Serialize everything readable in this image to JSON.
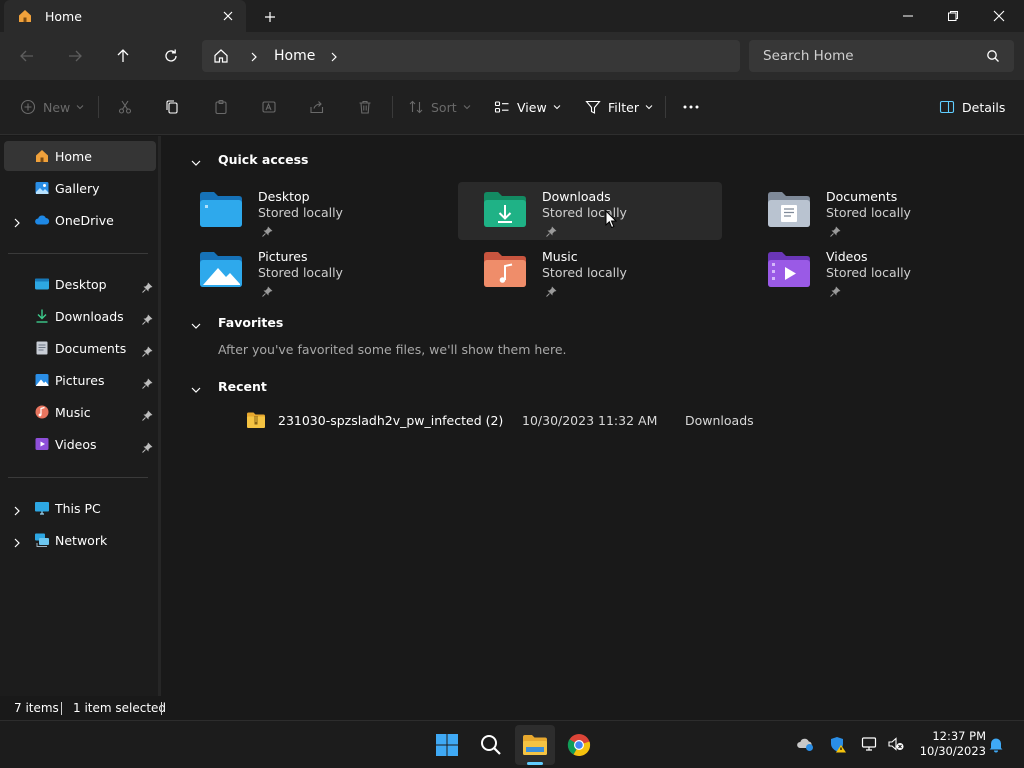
{
  "window": {
    "tab_title": "Home",
    "new_tab": "+",
    "minimize_icon": "minimize-icon",
    "maximize_icon": "maximize-icon",
    "close_icon": "close-icon"
  },
  "navbar": {
    "back_icon": "arrow-left-icon",
    "forward_icon": "arrow-right-icon",
    "up_icon": "arrow-up-icon",
    "refresh_icon": "refresh-icon",
    "breadcrumb": "Home",
    "search_placeholder": "Search Home"
  },
  "commands": {
    "new": "New",
    "sort": "Sort",
    "view": "View",
    "filter": "Filter",
    "details": "Details"
  },
  "sidebar": {
    "top": [
      {
        "label": "Home",
        "icon": "home-icon",
        "selected": true
      },
      {
        "label": "Gallery",
        "icon": "gallery-icon"
      },
      {
        "label": "OneDrive",
        "icon": "cloud-icon",
        "expandable": true
      }
    ],
    "pinned": [
      {
        "label": "Desktop",
        "icon": "desktop-folder-icon"
      },
      {
        "label": "Downloads",
        "icon": "downloads-icon"
      },
      {
        "label": "Documents",
        "icon": "documents-icon"
      },
      {
        "label": "Pictures",
        "icon": "pictures-icon"
      },
      {
        "label": "Music",
        "icon": "music-icon"
      },
      {
        "label": "Videos",
        "icon": "videos-icon"
      }
    ],
    "bottom": [
      {
        "label": "This PC",
        "icon": "computer-icon",
        "expandable": true
      },
      {
        "label": "Network",
        "icon": "network-icon",
        "expandable": true
      }
    ]
  },
  "quick_access": {
    "title": "Quick access",
    "items": [
      {
        "name": "Desktop",
        "status": "Stored locally",
        "icon": "desktop-folder-icon"
      },
      {
        "name": "Downloads",
        "status": "Stored locally",
        "icon": "downloads-folder-icon",
        "hover": true
      },
      {
        "name": "Documents",
        "status": "Stored locally",
        "icon": "documents-folder-icon"
      },
      {
        "name": "Pictures",
        "status": "Stored locally",
        "icon": "pictures-folder-icon"
      },
      {
        "name": "Music",
        "status": "Stored locally",
        "icon": "music-folder-icon"
      },
      {
        "name": "Videos",
        "status": "Stored locally",
        "icon": "videos-folder-icon"
      }
    ]
  },
  "favorites": {
    "title": "Favorites",
    "empty_text": "After you've favorited some files, we'll show them here."
  },
  "recent": {
    "title": "Recent",
    "items": [
      {
        "name": "231030-spzsladh2v_pw_infected (2)",
        "date": "10/30/2023 11:32 AM",
        "location": "Downloads",
        "icon": "zip-folder-icon"
      }
    ]
  },
  "status": {
    "items_count": "7 items",
    "selection": "1 item selected"
  },
  "taskbar": {
    "apps": [
      "windows-start-icon",
      "search-icon",
      "file-explorer-icon",
      "chrome-icon"
    ],
    "tray": [
      "onedrive-icon",
      "defender-icon",
      "network-icon",
      "volume-muted-icon"
    ],
    "time": "12:37 PM",
    "date": "10/30/2023",
    "notification_icon": "bell-icon"
  },
  "colors": {
    "accent": "#60cdff",
    "folder_yellow": "#f5c342",
    "background": "#191919"
  }
}
